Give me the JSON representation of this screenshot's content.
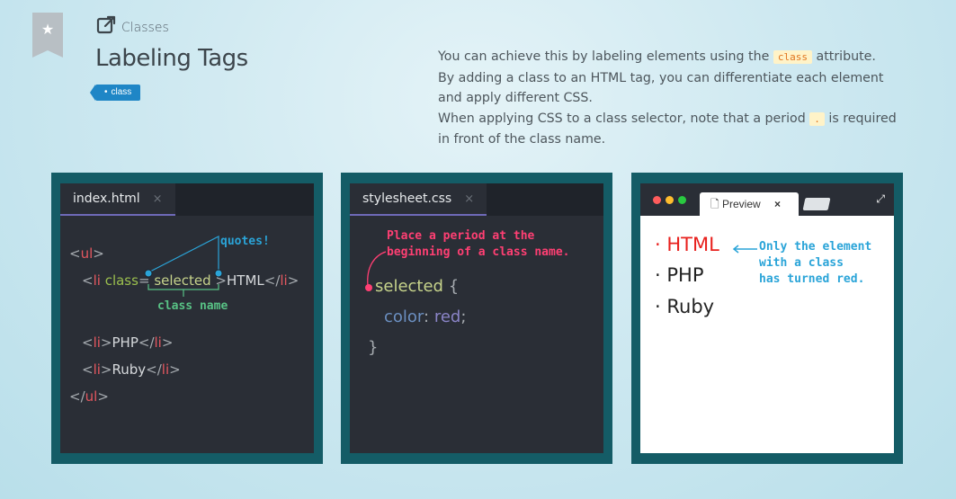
{
  "header": {
    "breadcrumb": "Classes",
    "title": "Labeling Tags",
    "tag": "class"
  },
  "description": {
    "l1a": "You can achieve this by labeling elements using the",
    "l1code": "class",
    "l1b": "attribute.",
    "l2": "By adding a class to an HTML tag, you can differentiate each element",
    "l3": "and apply different CSS.",
    "l4a": "When applying CSS to a class selector, note that a period",
    "l4code": ".",
    "l4b": "is required",
    "l5": "in front of the class name."
  },
  "html_editor": {
    "tab": "index.html",
    "close": "×",
    "lt": "<",
    "gt": ">",
    "lt_slash": "</",
    "ul": "ul",
    "li": "li",
    "class_attr": "class",
    "eq": "=",
    "selected_val": "selected",
    "html_text": "HTML",
    "php_text": "PHP",
    "ruby_text": "Ruby",
    "ann_quotes": "quotes!",
    "ann_class_name": "class name"
  },
  "css_editor": {
    "tab": "stylesheet.css",
    "close": "×",
    "ann_line1": "Place a period at the",
    "ann_line2": "beginning of a class name.",
    "selector": "selected",
    "brace_open": "{",
    "prop": "color",
    "colon": ":",
    "value": "red",
    "semi": ";",
    "brace_close": "}"
  },
  "preview": {
    "tab": "Preview",
    "close": "×",
    "items": [
      "HTML",
      "PHP",
      "Ruby"
    ],
    "bullet": "·",
    "ann_line1": "Only the element",
    "ann_line2": "with a class",
    "ann_line3": "has turned red."
  },
  "colors": {
    "accent": "#1f86c6",
    "panel": "#145c66",
    "editor_bg": "#2a2e36",
    "tag": "#e4575f",
    "green_annotation": "#58c285",
    "pink_annotation": "#ff3f73",
    "blue_annotation": "#2aa4d8",
    "red_text": "#e8201d"
  },
  "icons": [
    "bookmark-star-icon",
    "external-link-icon",
    "file-icon",
    "expand-icon"
  ]
}
